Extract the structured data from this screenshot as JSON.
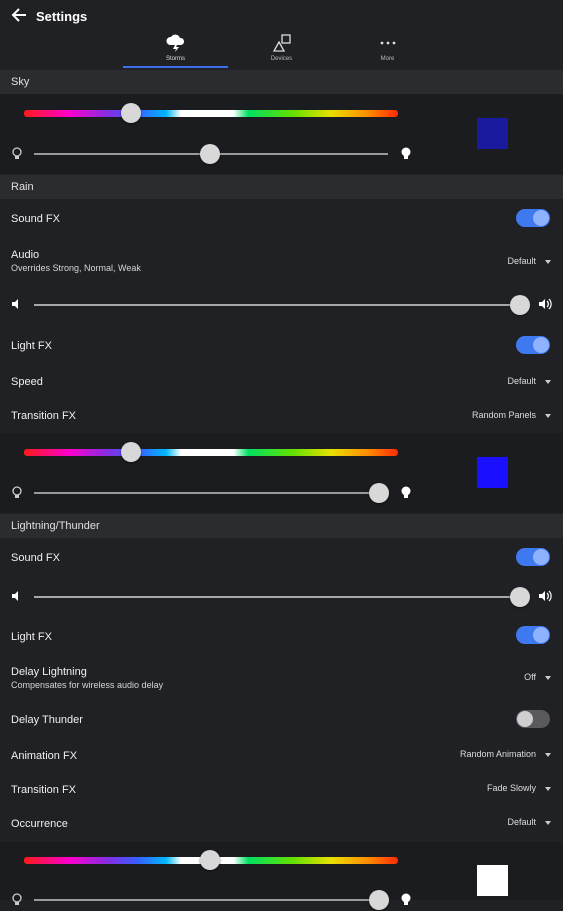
{
  "header": {
    "title": "Settings"
  },
  "tabs": [
    {
      "label": "Storms",
      "icon": "storm-cloud-icon",
      "active": true
    },
    {
      "label": "Devices",
      "icon": "devices-shapes-icon",
      "active": false
    },
    {
      "label": "More",
      "icon": "more-dots-icon",
      "active": false
    }
  ],
  "sky": {
    "header": "Sky",
    "hue_position": 0.28,
    "brightness": 0.5,
    "swatch_color": "#1a1a9e"
  },
  "rain": {
    "header": "Rain",
    "sound_fx": {
      "label": "Sound FX",
      "on": true
    },
    "audio": {
      "label": "Audio",
      "sub": "Overrides Strong, Normal, Weak",
      "value": "Default"
    },
    "volume": 1.0,
    "light_fx": {
      "label": "Light FX",
      "on": true
    },
    "speed": {
      "label": "Speed",
      "value": "Default"
    },
    "transition_fx": {
      "label": "Transition FX",
      "value": "Random Panels"
    },
    "hue_position": 0.28,
    "brightness": 1.0,
    "swatch_color": "#1a0fff"
  },
  "lightning": {
    "header": "Lightning/Thunder",
    "sound_fx": {
      "label": "Sound FX",
      "on": true
    },
    "volume": 1.0,
    "light_fx": {
      "label": "Light FX",
      "on": true
    },
    "delay_lightning": {
      "label": "Delay Lightning",
      "sub": "Compensates for wireless audio delay",
      "value": "Off"
    },
    "delay_thunder": {
      "label": "Delay Thunder",
      "on": false
    },
    "animation_fx": {
      "label": "Animation FX",
      "value": "Random Animation"
    },
    "transition_fx": {
      "label": "Transition FX",
      "value": "Fade Slowly"
    },
    "occurrence": {
      "label": "Occurrence",
      "value": "Default"
    },
    "hue_position": 0.5,
    "brightness": 1.0,
    "swatch_color": "#ffffff"
  },
  "colors": {
    "accent": "#3f79f0",
    "background": "#202124",
    "section": "#2b2c30"
  }
}
